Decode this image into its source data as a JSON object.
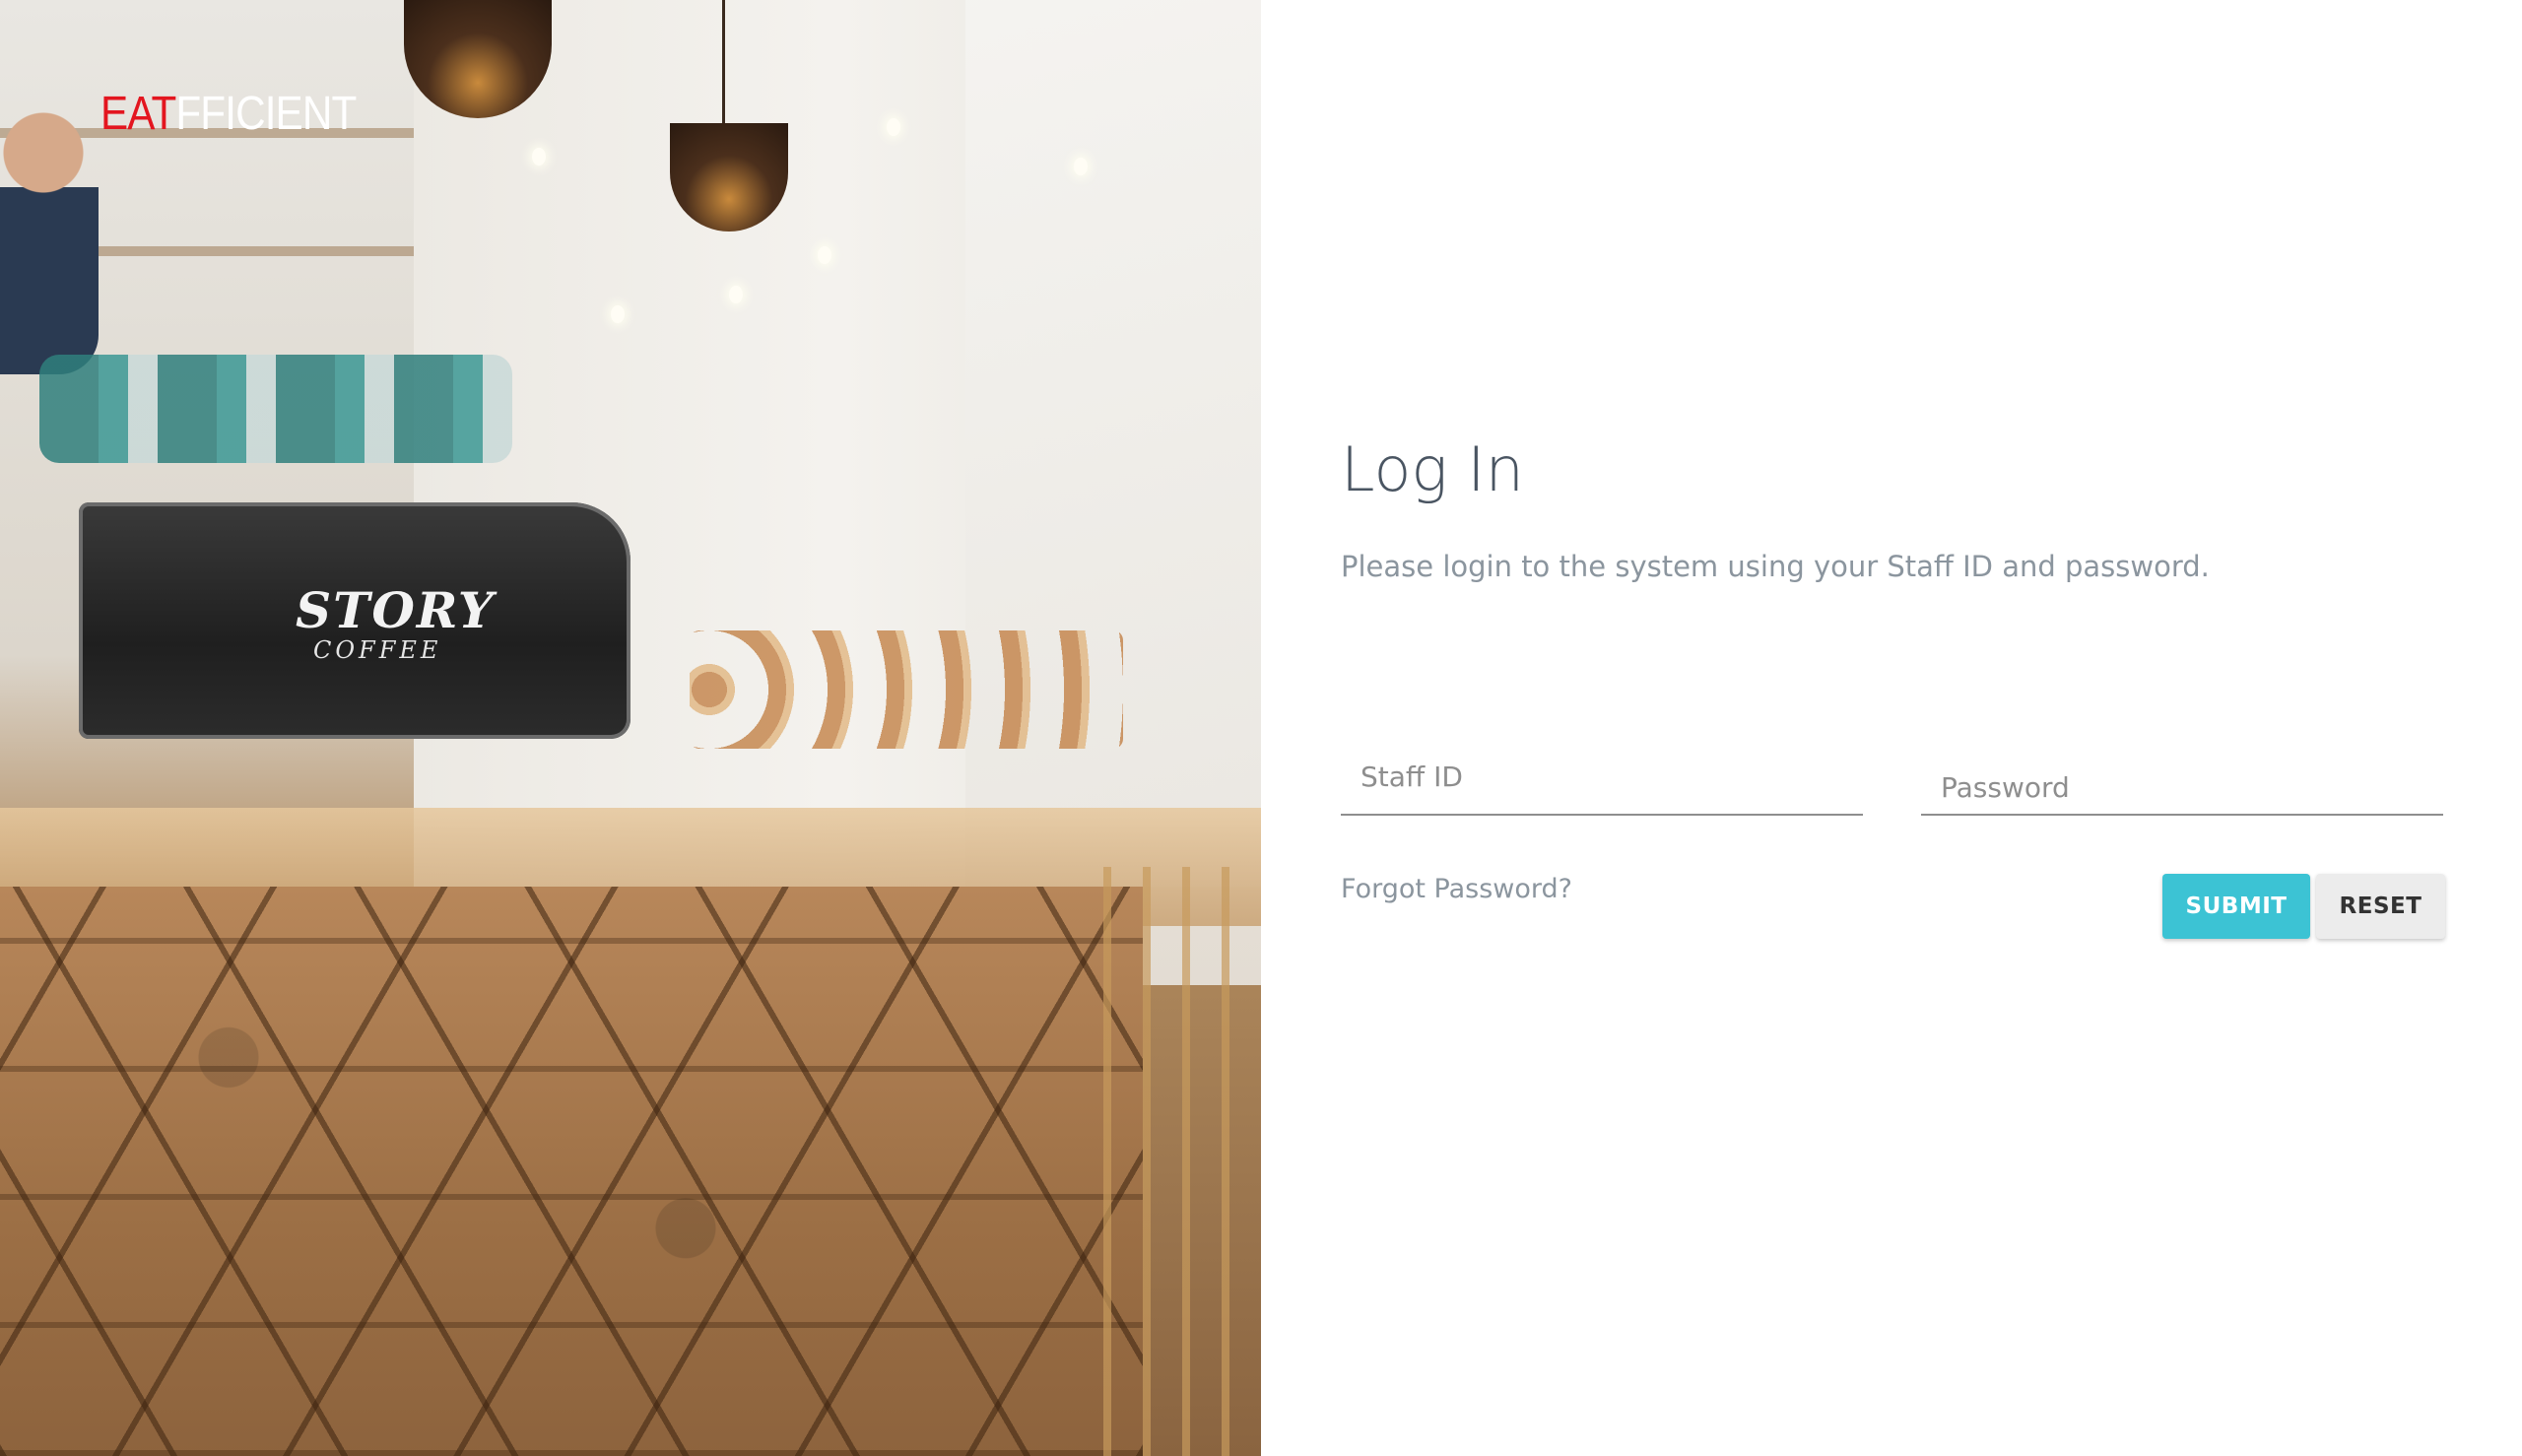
{
  "brand": {
    "logo_part1": "EAT",
    "logo_part2": "FFICIENT",
    "logo_red": "#e3161f",
    "logo_white": "#ffffff"
  },
  "hero": {
    "sign_line1": "STORY",
    "sign_line2": "COFFEE"
  },
  "login": {
    "title": "Log In",
    "subtitle": "Please login to the system using your Staff ID and password.",
    "staff_id_placeholder": "Staff ID",
    "password_placeholder": "Password",
    "forgot_label": "Forgot Password?",
    "submit_label": "SUBMIT",
    "reset_label": "RESET"
  },
  "colors": {
    "accent": "#3cc3d4",
    "title_text": "#4a5562",
    "muted_text": "#8b959e"
  }
}
